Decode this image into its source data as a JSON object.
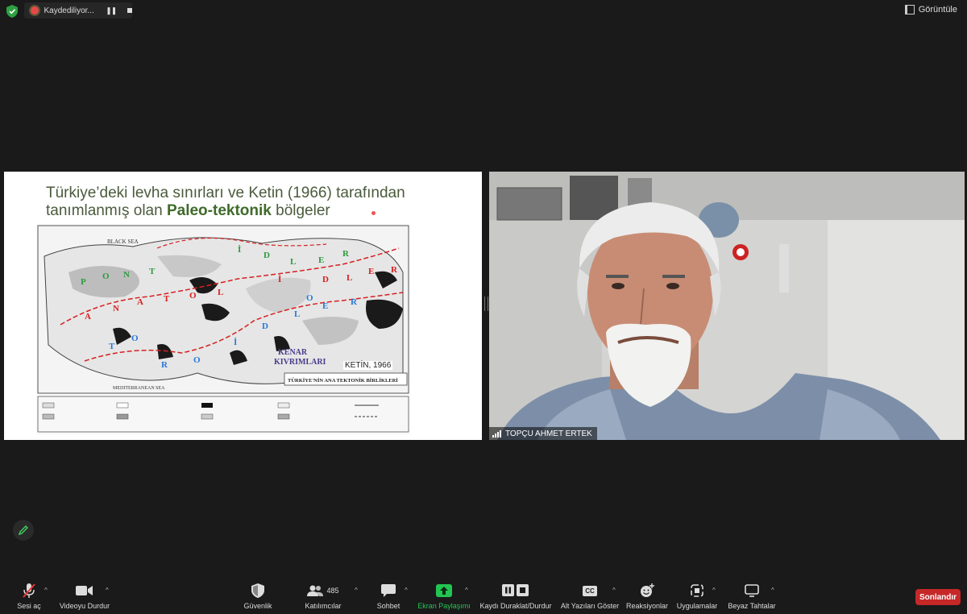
{
  "topbar": {
    "recording_label": "Kaydediliyor...",
    "pause_glyph": "❚❚",
    "view_label": "Görüntüle"
  },
  "slide": {
    "title_line1": "Türkiye’deki levha sınırları ve Ketin (1966) tarafından",
    "title_line2_prefix": "tanımlanmış olan ",
    "title_line2_bold": "Paleo-tektonik",
    "title_line2_suffix": " bölgeler",
    "map_caption": "KETİN, 1966",
    "map_labels": {
      "black_sea": "BLACK        SEA",
      "mediterranean": "MEDITERRANEAN SEA",
      "kenar_1": "KENAR",
      "kenar_2": "KIVRIMLARI",
      "legend_title": "TÜRKİYE'NİN ANA TEKTONİK BİRLİKLERİ"
    }
  },
  "video": {
    "participant_name": "TOPÇU AHMET ERTEK"
  },
  "toolbar": {
    "mute_label": "Sesi aç",
    "video_label": "Videoyu Durdur",
    "security_label": "Güvenlik",
    "participants_label": "Katılımcılar",
    "participants_count": "485",
    "chat_label": "Sohbet",
    "share_label": "Ekran Paylaşımı",
    "record_label": "Kaydı Duraklat/Durdur",
    "captions_label": "Alt Yazıları Göster",
    "captions_badge": "CC",
    "reactions_label": "Reaksiyonlar",
    "apps_label": "Uygulamalar",
    "whiteboard_label": "Beyaz Tahtalar",
    "end_label": "Sonlandır",
    "caret": "^"
  },
  "colors": {
    "background": "#1a1a1a",
    "share_green": "#23c552",
    "end_red": "#c62828",
    "title_green": "#3f6b2a"
  }
}
